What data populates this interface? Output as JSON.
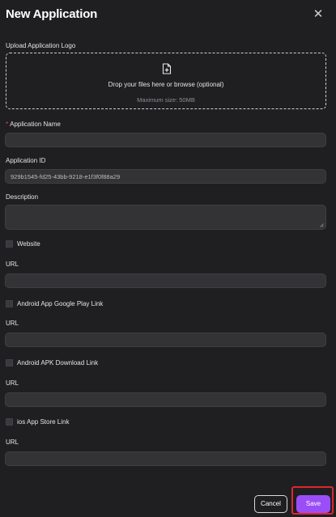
{
  "dialog": {
    "title": "New Application",
    "close_icon": "close-icon"
  },
  "upload": {
    "label": "Upload Application Logo",
    "icon": "file-plus-icon",
    "prompt": "Drop your files here or browse (optional)",
    "hint": "Maximum size: 50MB"
  },
  "fields": {
    "app_name": {
      "required_mark": "*",
      "label": "Application Name",
      "value": ""
    },
    "app_id": {
      "label": "Application ID",
      "value": "929b1545-fd25-43bb-9218-e1f3f0f88a29"
    },
    "description": {
      "label": "Description",
      "value": ""
    }
  },
  "platforms": [
    {
      "checkbox_label": "Website",
      "checked": false,
      "url_label": "URL",
      "url_value": ""
    },
    {
      "checkbox_label": "Android App Google Play Link",
      "checked": false,
      "url_label": "URL",
      "url_value": ""
    },
    {
      "checkbox_label": "Android APK Download Link",
      "checked": false,
      "url_label": "URL",
      "url_value": ""
    },
    {
      "checkbox_label": "ios App Store Link",
      "checked": false,
      "url_label": "URL",
      "url_value": ""
    }
  ],
  "footer": {
    "cancel_label": "Cancel",
    "save_label": "Save"
  },
  "colors": {
    "background": "#1f1f22",
    "input_bg": "#333235",
    "accent": "#9b4ef7",
    "highlight": "#e0262f",
    "required": "#e5484d"
  }
}
